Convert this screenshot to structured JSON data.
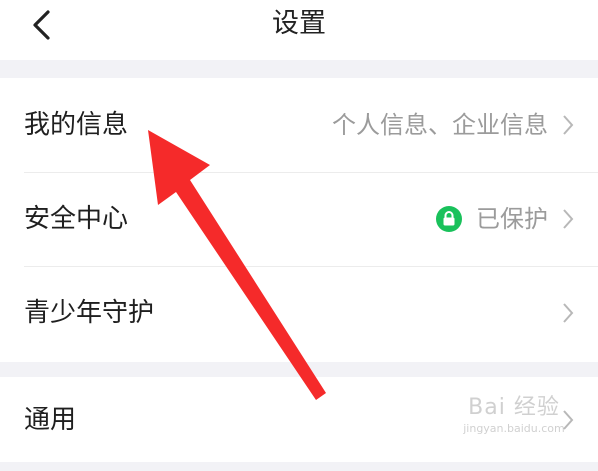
{
  "header": {
    "title": "设置"
  },
  "sections": [
    {
      "items": [
        {
          "label": "我的信息",
          "value": "个人信息、企业信息"
        },
        {
          "label": "安全中心",
          "value": "已保护",
          "status_color": "#19c15b"
        },
        {
          "label": "青少年守护",
          "value": ""
        }
      ]
    },
    {
      "items": [
        {
          "label": "通用",
          "value": ""
        }
      ]
    }
  ],
  "annotation": {
    "arrow_color": "#f52a2a"
  },
  "watermark": {
    "text": "Bai 经验",
    "url": "jingyan.baidu.com"
  }
}
